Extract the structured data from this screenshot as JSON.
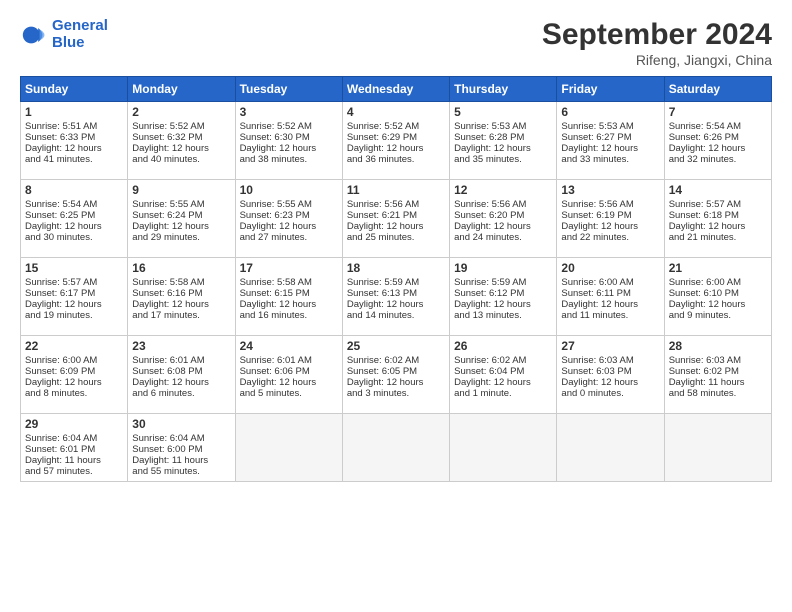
{
  "header": {
    "logo_line1": "General",
    "logo_line2": "Blue",
    "month": "September 2024",
    "location": "Rifeng, Jiangxi, China"
  },
  "weekdays": [
    "Sunday",
    "Monday",
    "Tuesday",
    "Wednesday",
    "Thursday",
    "Friday",
    "Saturday"
  ],
  "weeks": [
    [
      {
        "day": 1,
        "lines": [
          "Sunrise: 5:51 AM",
          "Sunset: 6:33 PM",
          "Daylight: 12 hours",
          "and 41 minutes."
        ]
      },
      {
        "day": 2,
        "lines": [
          "Sunrise: 5:52 AM",
          "Sunset: 6:32 PM",
          "Daylight: 12 hours",
          "and 40 minutes."
        ]
      },
      {
        "day": 3,
        "lines": [
          "Sunrise: 5:52 AM",
          "Sunset: 6:30 PM",
          "Daylight: 12 hours",
          "and 38 minutes."
        ]
      },
      {
        "day": 4,
        "lines": [
          "Sunrise: 5:52 AM",
          "Sunset: 6:29 PM",
          "Daylight: 12 hours",
          "and 36 minutes."
        ]
      },
      {
        "day": 5,
        "lines": [
          "Sunrise: 5:53 AM",
          "Sunset: 6:28 PM",
          "Daylight: 12 hours",
          "and 35 minutes."
        ]
      },
      {
        "day": 6,
        "lines": [
          "Sunrise: 5:53 AM",
          "Sunset: 6:27 PM",
          "Daylight: 12 hours",
          "and 33 minutes."
        ]
      },
      {
        "day": 7,
        "lines": [
          "Sunrise: 5:54 AM",
          "Sunset: 6:26 PM",
          "Daylight: 12 hours",
          "and 32 minutes."
        ]
      }
    ],
    [
      {
        "day": 8,
        "lines": [
          "Sunrise: 5:54 AM",
          "Sunset: 6:25 PM",
          "Daylight: 12 hours",
          "and 30 minutes."
        ]
      },
      {
        "day": 9,
        "lines": [
          "Sunrise: 5:55 AM",
          "Sunset: 6:24 PM",
          "Daylight: 12 hours",
          "and 29 minutes."
        ]
      },
      {
        "day": 10,
        "lines": [
          "Sunrise: 5:55 AM",
          "Sunset: 6:23 PM",
          "Daylight: 12 hours",
          "and 27 minutes."
        ]
      },
      {
        "day": 11,
        "lines": [
          "Sunrise: 5:56 AM",
          "Sunset: 6:21 PM",
          "Daylight: 12 hours",
          "and 25 minutes."
        ]
      },
      {
        "day": 12,
        "lines": [
          "Sunrise: 5:56 AM",
          "Sunset: 6:20 PM",
          "Daylight: 12 hours",
          "and 24 minutes."
        ]
      },
      {
        "day": 13,
        "lines": [
          "Sunrise: 5:56 AM",
          "Sunset: 6:19 PM",
          "Daylight: 12 hours",
          "and 22 minutes."
        ]
      },
      {
        "day": 14,
        "lines": [
          "Sunrise: 5:57 AM",
          "Sunset: 6:18 PM",
          "Daylight: 12 hours",
          "and 21 minutes."
        ]
      }
    ],
    [
      {
        "day": 15,
        "lines": [
          "Sunrise: 5:57 AM",
          "Sunset: 6:17 PM",
          "Daylight: 12 hours",
          "and 19 minutes."
        ]
      },
      {
        "day": 16,
        "lines": [
          "Sunrise: 5:58 AM",
          "Sunset: 6:16 PM",
          "Daylight: 12 hours",
          "and 17 minutes."
        ]
      },
      {
        "day": 17,
        "lines": [
          "Sunrise: 5:58 AM",
          "Sunset: 6:15 PM",
          "Daylight: 12 hours",
          "and 16 minutes."
        ]
      },
      {
        "day": 18,
        "lines": [
          "Sunrise: 5:59 AM",
          "Sunset: 6:13 PM",
          "Daylight: 12 hours",
          "and 14 minutes."
        ]
      },
      {
        "day": 19,
        "lines": [
          "Sunrise: 5:59 AM",
          "Sunset: 6:12 PM",
          "Daylight: 12 hours",
          "and 13 minutes."
        ]
      },
      {
        "day": 20,
        "lines": [
          "Sunrise: 6:00 AM",
          "Sunset: 6:11 PM",
          "Daylight: 12 hours",
          "and 11 minutes."
        ]
      },
      {
        "day": 21,
        "lines": [
          "Sunrise: 6:00 AM",
          "Sunset: 6:10 PM",
          "Daylight: 12 hours",
          "and 9 minutes."
        ]
      }
    ],
    [
      {
        "day": 22,
        "lines": [
          "Sunrise: 6:00 AM",
          "Sunset: 6:09 PM",
          "Daylight: 12 hours",
          "and 8 minutes."
        ]
      },
      {
        "day": 23,
        "lines": [
          "Sunrise: 6:01 AM",
          "Sunset: 6:08 PM",
          "Daylight: 12 hours",
          "and 6 minutes."
        ]
      },
      {
        "day": 24,
        "lines": [
          "Sunrise: 6:01 AM",
          "Sunset: 6:06 PM",
          "Daylight: 12 hours",
          "and 5 minutes."
        ]
      },
      {
        "day": 25,
        "lines": [
          "Sunrise: 6:02 AM",
          "Sunset: 6:05 PM",
          "Daylight: 12 hours",
          "and 3 minutes."
        ]
      },
      {
        "day": 26,
        "lines": [
          "Sunrise: 6:02 AM",
          "Sunset: 6:04 PM",
          "Daylight: 12 hours",
          "and 1 minute."
        ]
      },
      {
        "day": 27,
        "lines": [
          "Sunrise: 6:03 AM",
          "Sunset: 6:03 PM",
          "Daylight: 12 hours",
          "and 0 minutes."
        ]
      },
      {
        "day": 28,
        "lines": [
          "Sunrise: 6:03 AM",
          "Sunset: 6:02 PM",
          "Daylight: 11 hours",
          "and 58 minutes."
        ]
      }
    ],
    [
      {
        "day": 29,
        "lines": [
          "Sunrise: 6:04 AM",
          "Sunset: 6:01 PM",
          "Daylight: 11 hours",
          "and 57 minutes."
        ]
      },
      {
        "day": 30,
        "lines": [
          "Sunrise: 6:04 AM",
          "Sunset: 6:00 PM",
          "Daylight: 11 hours",
          "and 55 minutes."
        ]
      },
      {
        "day": null,
        "lines": []
      },
      {
        "day": null,
        "lines": []
      },
      {
        "day": null,
        "lines": []
      },
      {
        "day": null,
        "lines": []
      },
      {
        "day": null,
        "lines": []
      }
    ]
  ]
}
